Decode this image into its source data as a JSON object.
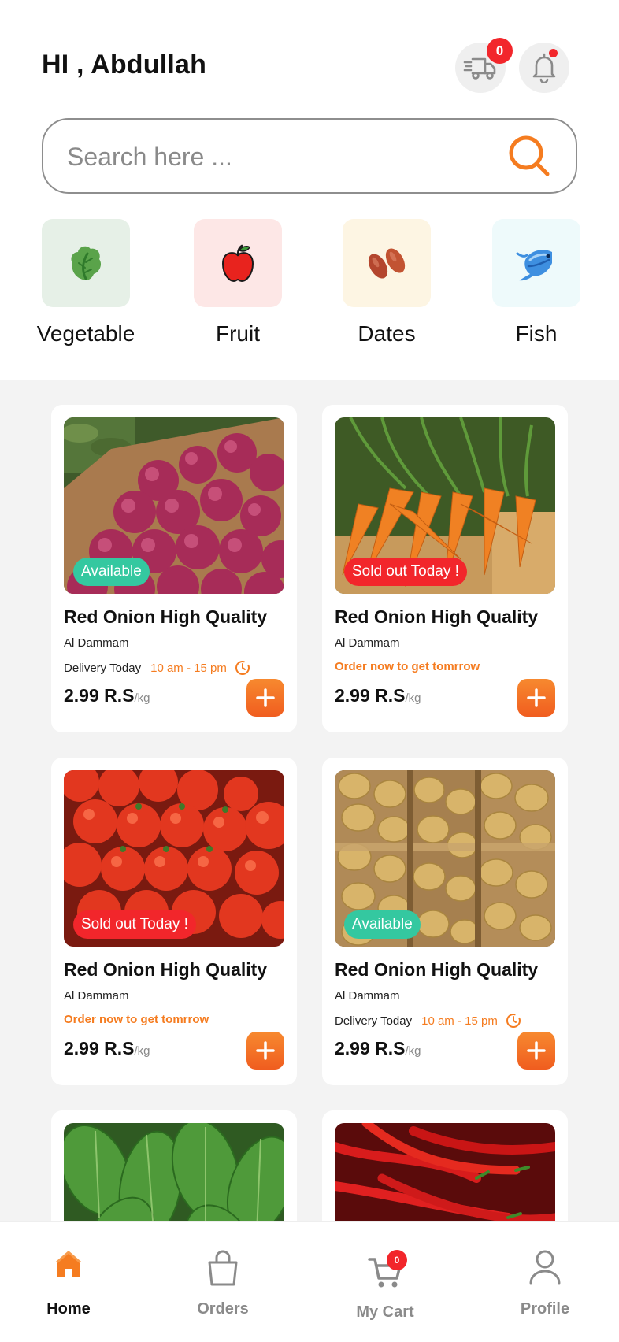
{
  "header": {
    "greeting": "HI , Abdullah",
    "delivery_badge": "0"
  },
  "search": {
    "placeholder": "Search here ..."
  },
  "categories": [
    {
      "label": "Vegetable",
      "icon": "lettuce-icon",
      "bg": "#e6f0e7"
    },
    {
      "label": "Fruit",
      "icon": "apple-icon",
      "bg": "#fde7e6"
    },
    {
      "label": "Dates",
      "icon": "dates-icon",
      "bg": "#fdf5e3"
    },
    {
      "label": "Fish",
      "icon": "fish-icon",
      "bg": "#eefafb"
    }
  ],
  "products": [
    {
      "title": "Red Onion High Quality",
      "location": "Al Dammam",
      "status": "Available",
      "delivery_label": "Delivery Today",
      "delivery_time": "10 am - 15 pm",
      "price": "2.99 R.S",
      "unit": "/kg",
      "image": "red-onions"
    },
    {
      "title": "Red Onion High Quality",
      "location": "Al Dammam",
      "status": "Sold out Today !",
      "order_note": "Order now to get tomrrow",
      "price": "2.99 R.S",
      "unit": "/kg",
      "image": "carrots"
    },
    {
      "title": "Red Onion High Quality",
      "location": "Al Dammam",
      "status": "Sold out Today !",
      "order_note": "Order now to get tomrrow",
      "price": "2.99 R.S",
      "unit": "/kg",
      "image": "tomatoes"
    },
    {
      "title": "Red Onion High Quality",
      "location": "Al Dammam",
      "status": "Available",
      "delivery_label": "Delivery Today",
      "delivery_time": "10 am - 15 pm",
      "price": "2.99 R.S",
      "unit": "/kg",
      "image": "potatoes"
    },
    {
      "image": "spinach"
    },
    {
      "image": "red-chilies"
    }
  ],
  "nav": {
    "home": "Home",
    "orders": "Orders",
    "cart": "My Cart",
    "cart_badge": "0",
    "profile": "Profile"
  },
  "colors": {
    "accent": "#f57c20",
    "available": "#34c8a0",
    "soldout": "#f2262b"
  }
}
